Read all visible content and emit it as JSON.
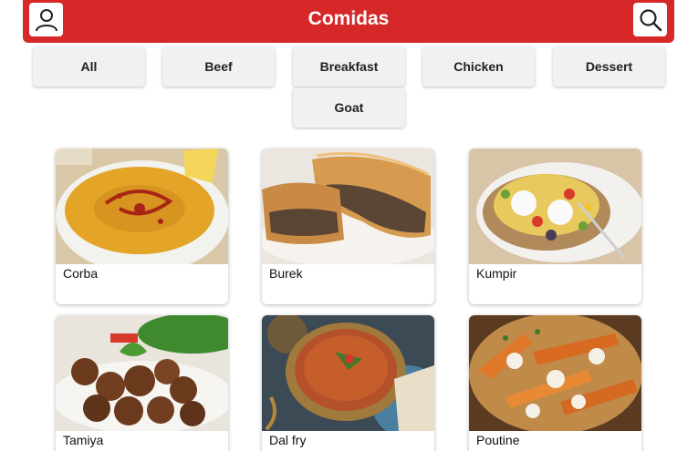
{
  "header": {
    "title": "Comidas",
    "profile_icon": "user-icon",
    "search_icon": "search-icon",
    "color": "#d62828"
  },
  "filters": [
    {
      "label": "All"
    },
    {
      "label": "Beef"
    },
    {
      "label": "Breakfast"
    },
    {
      "label": "Chicken"
    },
    {
      "label": "Dessert"
    },
    {
      "label": "Goat"
    }
  ],
  "meals": [
    {
      "name": "Corba"
    },
    {
      "name": "Burek"
    },
    {
      "name": "Kumpir"
    },
    {
      "name": "Tamiya"
    },
    {
      "name": "Dal fry"
    },
    {
      "name": "Poutine"
    }
  ]
}
